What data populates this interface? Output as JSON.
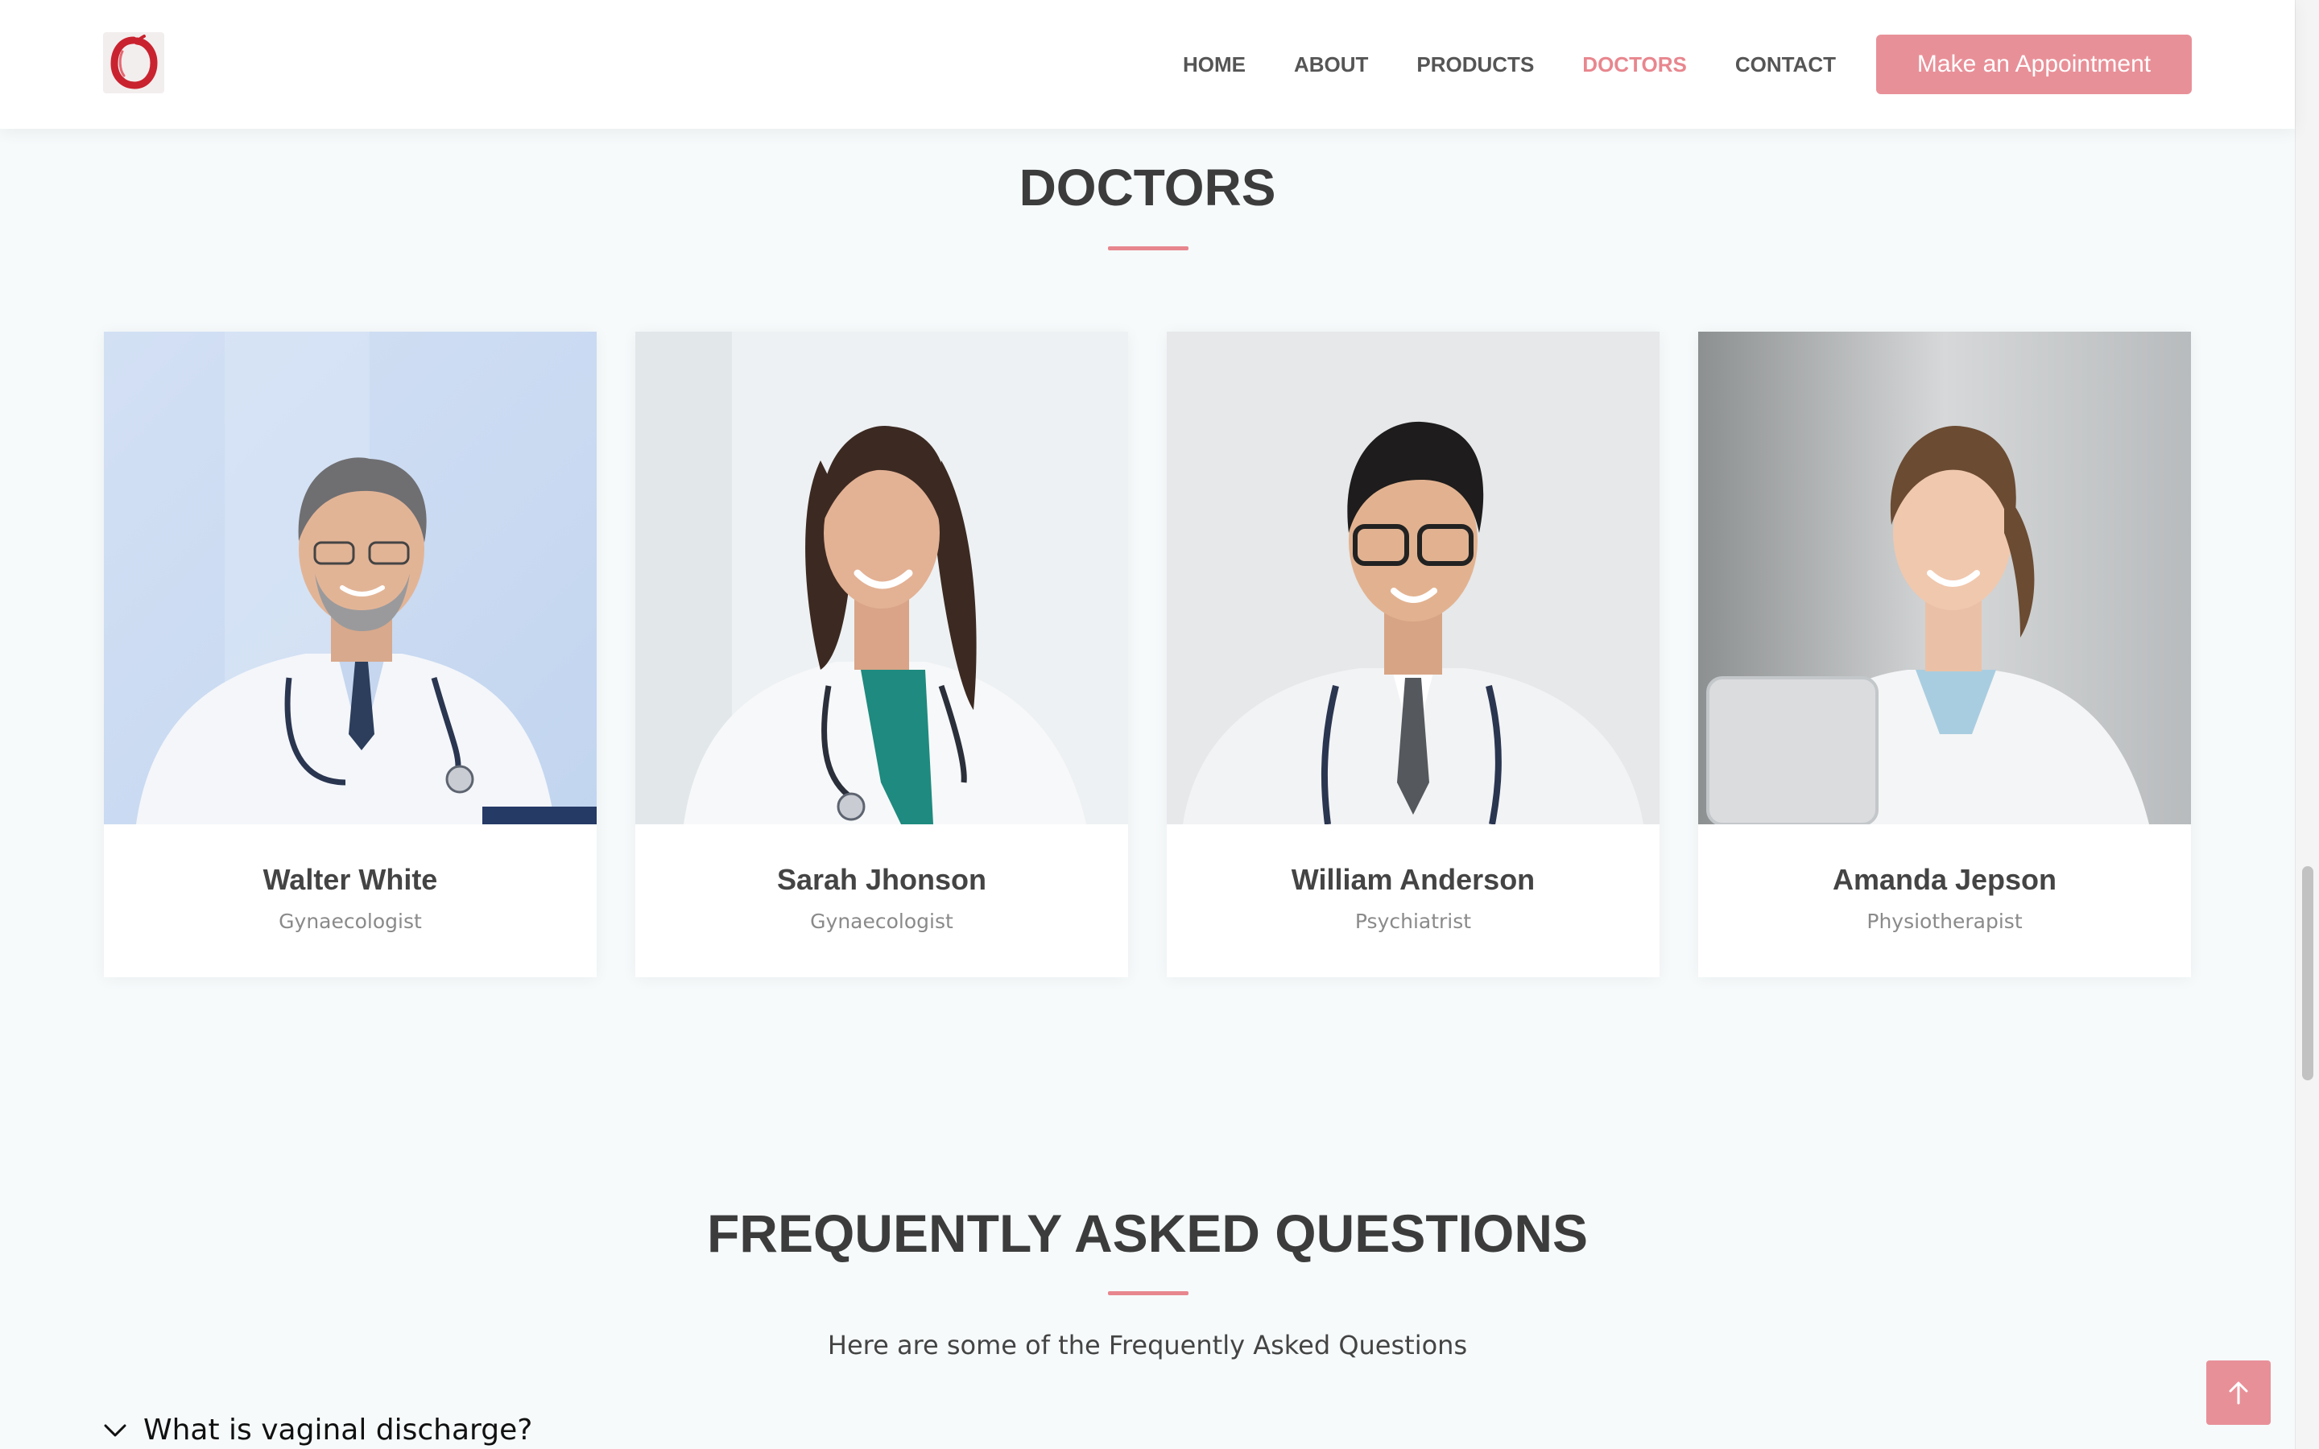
{
  "brand": {
    "accent": "#e8868e",
    "button_color": "#e89098",
    "logo_icon": "red-ring-logo"
  },
  "nav": {
    "items": [
      {
        "label": "HOME",
        "active": false
      },
      {
        "label": "ABOUT",
        "active": false
      },
      {
        "label": "PRODUCTS",
        "active": false
      },
      {
        "label": "DOCTORS",
        "active": true
      },
      {
        "label": "CONTACT",
        "active": false
      }
    ],
    "cta_label": "Make an Appointment"
  },
  "doctors_section": {
    "title": "DOCTORS",
    "doctors": [
      {
        "name": "Walter White",
        "role": "Gynaecologist"
      },
      {
        "name": "Sarah Jhonson",
        "role": "Gynaecologist"
      },
      {
        "name": "William Anderson",
        "role": "Psychiatrist"
      },
      {
        "name": "Amanda Jepson",
        "role": "Physiotherapist"
      }
    ]
  },
  "faq_section": {
    "title": "FREQUENTLY ASKED QUESTIONS",
    "subtitle": "Here are some of the Frequently Asked Questions",
    "questions": [
      {
        "question": "What is vaginal discharge?"
      }
    ]
  },
  "back_to_top": {
    "icon": "arrow-up-icon"
  }
}
